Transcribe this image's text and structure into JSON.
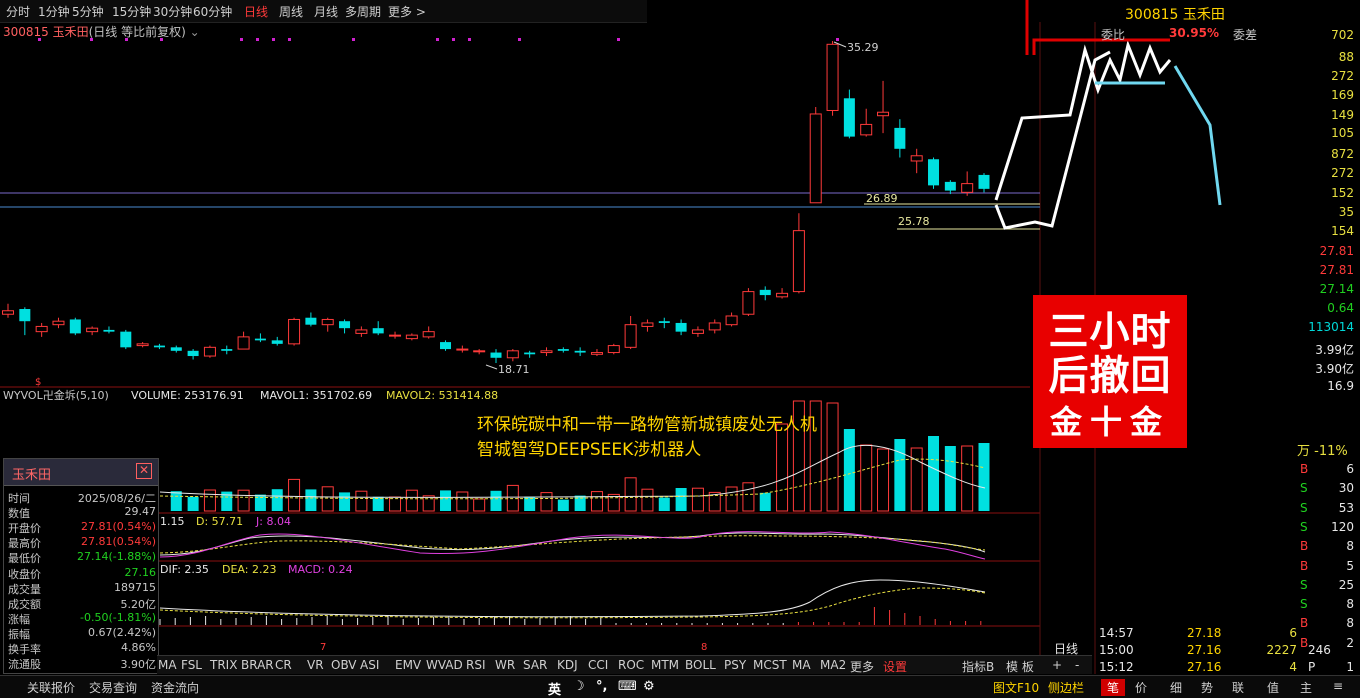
{
  "topbar": {
    "items": [
      "分时",
      "1分钟",
      "5分钟",
      "15分钟",
      "30分钟",
      "60分钟",
      "日线",
      "周线",
      "月线",
      "多周期",
      "更多 >"
    ],
    "active": "日线"
  },
  "stock": {
    "code_name": "300815 玉禾田",
    "mode": "(日线 等比前复权)",
    "short_name": "玉禾田"
  },
  "chart_data": {
    "type": "candlestick",
    "annotations": {
      "high": "35.29",
      "low": "18.71",
      "ma_a": "26.89",
      "ma_b": "25.78"
    },
    "candles": [
      {
        "o": 19.6,
        "c": 19.8,
        "h": 20.2,
        "l": 19.4
      },
      {
        "o": 19.9,
        "c": 19.2,
        "h": 20.0,
        "l": 18.4
      },
      {
        "o": 18.6,
        "c": 18.9,
        "h": 19.1,
        "l": 18.3
      },
      {
        "o": 19.0,
        "c": 19.2,
        "h": 19.4,
        "l": 18.8
      },
      {
        "o": 19.3,
        "c": 18.5,
        "h": 19.4,
        "l": 18.4
      },
      {
        "o": 18.6,
        "c": 18.8,
        "h": 18.9,
        "l": 18.4
      },
      {
        "o": 18.7,
        "c": 18.6,
        "h": 18.9,
        "l": 18.5
      },
      {
        "o": 18.6,
        "c": 17.7,
        "h": 18.7,
        "l": 17.6
      },
      {
        "o": 17.8,
        "c": 17.9,
        "h": 18.0,
        "l": 17.7
      },
      {
        "o": 17.8,
        "c": 17.7,
        "h": 17.9,
        "l": 17.6
      },
      {
        "o": 17.7,
        "c": 17.5,
        "h": 17.8,
        "l": 17.4
      },
      {
        "o": 17.5,
        "c": 17.2,
        "h": 17.6,
        "l": 17.0
      },
      {
        "o": 17.2,
        "c": 17.7,
        "h": 17.8,
        "l": 17.1
      },
      {
        "o": 17.6,
        "c": 17.5,
        "h": 17.8,
        "l": 17.3
      },
      {
        "o": 17.6,
        "c": 18.3,
        "h": 18.6,
        "l": 17.6
      },
      {
        "o": 18.2,
        "c": 18.1,
        "h": 18.5,
        "l": 18.0
      },
      {
        "o": 18.1,
        "c": 17.9,
        "h": 18.3,
        "l": 17.8
      },
      {
        "o": 17.9,
        "c": 19.3,
        "h": 19.4,
        "l": 17.8
      },
      {
        "o": 19.4,
        "c": 19.0,
        "h": 19.7,
        "l": 18.9
      },
      {
        "o": 19.0,
        "c": 19.3,
        "h": 19.4,
        "l": 18.6
      },
      {
        "o": 19.2,
        "c": 18.8,
        "h": 19.3,
        "l": 18.5
      },
      {
        "o": 18.5,
        "c": 18.7,
        "h": 18.9,
        "l": 18.3
      },
      {
        "o": 18.8,
        "c": 18.5,
        "h": 19.2,
        "l": 18.4
      },
      {
        "o": 18.4,
        "c": 18.4,
        "h": 18.6,
        "l": 18.2
      },
      {
        "o": 18.2,
        "c": 18.4,
        "h": 18.5,
        "l": 18.1
      },
      {
        "o": 18.3,
        "c": 18.6,
        "h": 18.9,
        "l": 18.2
      },
      {
        "o": 18.0,
        "c": 17.6,
        "h": 18.1,
        "l": 17.5
      },
      {
        "o": 17.6,
        "c": 17.6,
        "h": 17.8,
        "l": 17.4
      },
      {
        "o": 17.5,
        "c": 17.5,
        "h": 17.6,
        "l": 17.3
      },
      {
        "o": 17.4,
        "c": 17.1,
        "h": 17.6,
        "l": 16.8
      },
      {
        "o": 17.1,
        "c": 17.5,
        "h": 17.6,
        "l": 16.9
      },
      {
        "o": 17.4,
        "c": 17.3,
        "h": 17.5,
        "l": 17.1
      },
      {
        "o": 17.4,
        "c": 17.5,
        "h": 17.7,
        "l": 17.2
      },
      {
        "o": 17.6,
        "c": 17.5,
        "h": 17.7,
        "l": 17.4
      },
      {
        "o": 17.5,
        "c": 17.4,
        "h": 17.7,
        "l": 17.2
      },
      {
        "o": 17.3,
        "c": 17.4,
        "h": 17.6,
        "l": 17.2
      },
      {
        "o": 17.4,
        "c": 17.8,
        "h": 17.9,
        "l": 17.3
      },
      {
        "o": 17.7,
        "c": 19.0,
        "h": 19.5,
        "l": 17.6
      },
      {
        "o": 18.9,
        "c": 19.1,
        "h": 19.3,
        "l": 18.6
      },
      {
        "o": 19.2,
        "c": 19.1,
        "h": 19.4,
        "l": 18.8
      },
      {
        "o": 19.1,
        "c": 18.6,
        "h": 19.3,
        "l": 18.4
      },
      {
        "o": 18.5,
        "c": 18.7,
        "h": 18.9,
        "l": 18.3
      },
      {
        "o": 18.7,
        "c": 19.1,
        "h": 19.3,
        "l": 18.5
      },
      {
        "o": 19.0,
        "c": 19.5,
        "h": 19.7,
        "l": 18.9
      },
      {
        "o": 19.6,
        "c": 20.9,
        "h": 21.1,
        "l": 19.5
      },
      {
        "o": 21.0,
        "c": 20.7,
        "h": 21.2,
        "l": 20.4
      },
      {
        "o": 20.6,
        "c": 20.8,
        "h": 21.1,
        "l": 20.5
      },
      {
        "o": 20.9,
        "c": 24.4,
        "h": 25.4,
        "l": 20.8
      },
      {
        "o": 26.0,
        "c": 31.1,
        "h": 31.5,
        "l": 26.0
      },
      {
        "o": 31.3,
        "c": 35.1,
        "h": 35.29,
        "l": 31.0
      },
      {
        "o": 32.0,
        "c": 29.8,
        "h": 32.5,
        "l": 29.7
      },
      {
        "o": 29.9,
        "c": 30.5,
        "h": 31.4,
        "l": 29.8
      },
      {
        "o": 31.0,
        "c": 31.2,
        "h": 33.0,
        "l": 30.0
      },
      {
        "o": 30.3,
        "c": 29.1,
        "h": 30.8,
        "l": 28.6
      },
      {
        "o": 28.4,
        "c": 28.7,
        "h": 29.1,
        "l": 27.7
      },
      {
        "o": 28.5,
        "c": 27.0,
        "h": 28.6,
        "l": 26.8
      },
      {
        "o": 27.2,
        "c": 26.7,
        "h": 27.3,
        "l": 26.5
      },
      {
        "o": 26.6,
        "c": 27.1,
        "h": 27.8,
        "l": 26.4
      },
      {
        "o": 27.6,
        "c": 26.8,
        "h": 27.7,
        "l": 26.6
      }
    ],
    "volumes": [],
    "volume_labels": {
      "title": "WYVOL卍金坼(5,10)",
      "vol": "VOLUME: 253176.91",
      "mavol1": "MAVOL1: 351702.69",
      "mavol2": "MAVOL2: 531414.88"
    },
    "kdj_labels": {
      "k": "1.15",
      "d": "D: 57.71",
      "j": "J: 8.04"
    },
    "macd_labels": {
      "dif": "DIF: 2.35",
      "dea": "DEA: 2.23",
      "macd": "MACD: 0.24"
    }
  },
  "right_panel": {
    "header": "300815 玉禾田",
    "sub": [
      "委比",
      "30.95%",
      "委差"
    ],
    "top_vals": [
      "702",
      "88",
      "272",
      "169",
      "149",
      "105",
      "872",
      "272",
      "152",
      "35",
      "154"
    ],
    "prices": [
      {
        "v": "27.81",
        "c": "#ff3a3a"
      },
      {
        "v": "27.81",
        "c": "#ff3a3a"
      },
      {
        "v": "27.14",
        "c": "#20d020"
      },
      {
        "v": "0.64",
        "c": "#20d020"
      },
      {
        "v": "113014",
        "c": "#00d8d8"
      }
    ],
    "cap": [
      "3.99亿",
      "3.90亿",
      "16.9"
    ],
    "pct_row": "万  -11%",
    "trades": [
      {
        "t": "B",
        "v": "6"
      },
      {
        "t": "S",
        "v": "30"
      },
      {
        "t": "S",
        "v": "53"
      },
      {
        "t": "S",
        "v": "120"
      },
      {
        "t": "B",
        "v": "8"
      },
      {
        "t": "B",
        "v": "5"
      },
      {
        "t": "S",
        "v": "25"
      },
      {
        "t": "S",
        "v": "8"
      },
      {
        "t": "B",
        "v": "8"
      },
      {
        "t": "B",
        "v": "2"
      }
    ],
    "ticks": [
      {
        "time": "14:57",
        "price": "27.18",
        "vol": "6",
        "n": ""
      },
      {
        "time": "15:00",
        "price": "27.16",
        "vol": "2227",
        "n": "246"
      },
      {
        "time": "15:12",
        "price": "27.16",
        "vol": "4",
        "n": "P",
        "m": "1"
      }
    ],
    "rixian": "日线"
  },
  "overlay": {
    "box_line1": "三小时",
    "box_line2": "后撤回",
    "box_line3": "金十金",
    "topic1": "环保皖碳中和一带一路物管新城镇废处无人机",
    "topic2": "智城智驾DEEPSEEK涉机器人"
  },
  "infopanel": {
    "title": "玉禾田",
    "rows": [
      {
        "k": "时间",
        "v": "2025/08/26/二",
        "c": "#c8c8c8"
      },
      {
        "k": "数值",
        "v": "29.47",
        "c": "#c8c8c8"
      },
      {
        "k": "开盘价",
        "v": "27.81(0.54%)",
        "c": "#ff3a3a"
      },
      {
        "k": "最高价",
        "v": "27.81(0.54%)",
        "c": "#ff3a3a"
      },
      {
        "k": "最低价",
        "v": "27.14(-1.88%)",
        "c": "#20d020"
      },
      {
        "k": "收盘价",
        "v": "27.16",
        "c": "#20d020"
      },
      {
        "k": "成交量",
        "v": "189715",
        "c": "#c8c8c8"
      },
      {
        "k": "成交额",
        "v": "5.20亿",
        "c": "#c8c8c8"
      },
      {
        "k": "涨幅",
        "v": "-0.50(-1.81%)",
        "c": "#20d020"
      },
      {
        "k": "振幅",
        "v": "0.67(2.42%)",
        "c": "#c8c8c8"
      },
      {
        "k": "换手率",
        "v": "4.86%",
        "c": "#c8c8c8"
      },
      {
        "k": "流通股",
        "v": "3.90亿",
        "c": "#c8c8c8"
      }
    ]
  },
  "indicator_bar": [
    "MA",
    "FSL",
    "TRIX",
    "BRAR",
    "CR",
    "VR",
    "OBV",
    "ASI",
    "EMV",
    "WVAD",
    "RSI",
    "WR",
    "SAR",
    "KDJ",
    "CCI",
    "ROC",
    "MTM",
    "BOLL",
    "PSY",
    "MCST",
    "MA",
    "MA2",
    "更多",
    "设置",
    "指标B",
    "模 板",
    "+",
    "-"
  ],
  "bottom_bar": {
    "left": [
      "关联报价",
      "交易查询",
      "资金流向"
    ],
    "ime": [
      "英",
      "☽",
      "°,",
      "⌨",
      "⚙"
    ],
    "mid": [
      "图文F10",
      "侧边栏"
    ],
    "right": [
      "笔",
      "价",
      "细",
      "势",
      "联",
      "值",
      "主",
      "≡"
    ]
  },
  "colors": {
    "up": "#ff3a3a",
    "down": "#00e0e0",
    "bg": "#000000"
  }
}
